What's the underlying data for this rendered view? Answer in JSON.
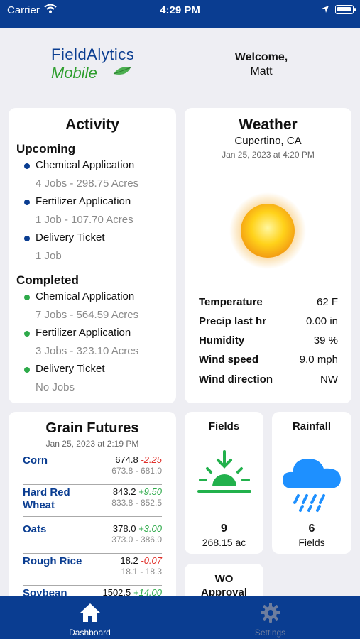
{
  "status_bar": {
    "carrier": "Carrier",
    "time": "4:29 PM"
  },
  "logo": {
    "line1": "FieldAlytics",
    "line2": "Mobile"
  },
  "welcome": {
    "greeting": "Welcome,",
    "name": "Matt"
  },
  "activity": {
    "title": "Activity",
    "upcoming_label": "Upcoming",
    "upcoming": [
      {
        "label": "Chemical Application",
        "detail": "4 Jobs - 298.75 Acres"
      },
      {
        "label": "Fertilizer Application",
        "detail": "1 Job - 107.70 Acres"
      },
      {
        "label": "Delivery Ticket",
        "detail": "1 Job"
      }
    ],
    "completed_label": "Completed",
    "completed": [
      {
        "label": "Chemical Application",
        "detail": "7 Jobs - 564.59 Acres"
      },
      {
        "label": "Fertilizer Application",
        "detail": "3 Jobs - 323.10 Acres"
      },
      {
        "label": "Delivery Ticket",
        "detail": "No Jobs"
      }
    ],
    "colors": {
      "upcoming": "#0a3d91",
      "completed": "#2eaa4a"
    }
  },
  "weather": {
    "title": "Weather",
    "city": "Cupertino, CA",
    "date": "Jan 25, 2023 at 4:20 PM",
    "icon": "sun-icon",
    "rows": [
      {
        "label": "Temperature",
        "value": "62 F"
      },
      {
        "label": "Precip last hr",
        "value": "0.00 in"
      },
      {
        "label": "Humidity",
        "value": "39 %"
      },
      {
        "label": "Wind speed",
        "value": "9.0 mph"
      },
      {
        "label": "Wind direction",
        "value": "NW"
      }
    ]
  },
  "grain": {
    "title": "Grain Futures",
    "date": "Jan 25, 2023 at 2:19 PM",
    "rows": [
      {
        "name": "Corn",
        "price": "674.8",
        "change": "-2.25",
        "range": "673.8 - 681.0"
      },
      {
        "name": "Hard Red Wheat",
        "price": "843.2",
        "change": "+9.50",
        "range": "833.8 - 852.5"
      },
      {
        "name": "Oats",
        "price": "378.0",
        "change": "+3.00",
        "range": "373.0 - 386.0"
      },
      {
        "name": "Rough Rice",
        "price": "18.2",
        "change": "-0.07",
        "range": "18.1 - 18.3"
      },
      {
        "name": "Soybean",
        "price": "1502.5",
        "change": "+14.00",
        "range": ""
      }
    ],
    "colors": {
      "up": "#2eaa4a",
      "down": "#e0302a"
    }
  },
  "fields": {
    "title": "Fields",
    "count": "9",
    "acres": "268.15 ac",
    "icon": "sunrise-icon"
  },
  "rainfall": {
    "title": "Rainfall",
    "count": "6",
    "label": "Fields",
    "icon": "rain-cloud-icon"
  },
  "wo": {
    "title_line1": "WO",
    "title_line2": "Approval"
  },
  "tabs": [
    {
      "label": "Dashboard",
      "icon": "home-icon",
      "active": true
    },
    {
      "label": "Settings",
      "icon": "gear-icon",
      "active": false
    }
  ],
  "colors": {
    "brand": "#0a3d91",
    "accent_green": "#2e9e2e"
  }
}
